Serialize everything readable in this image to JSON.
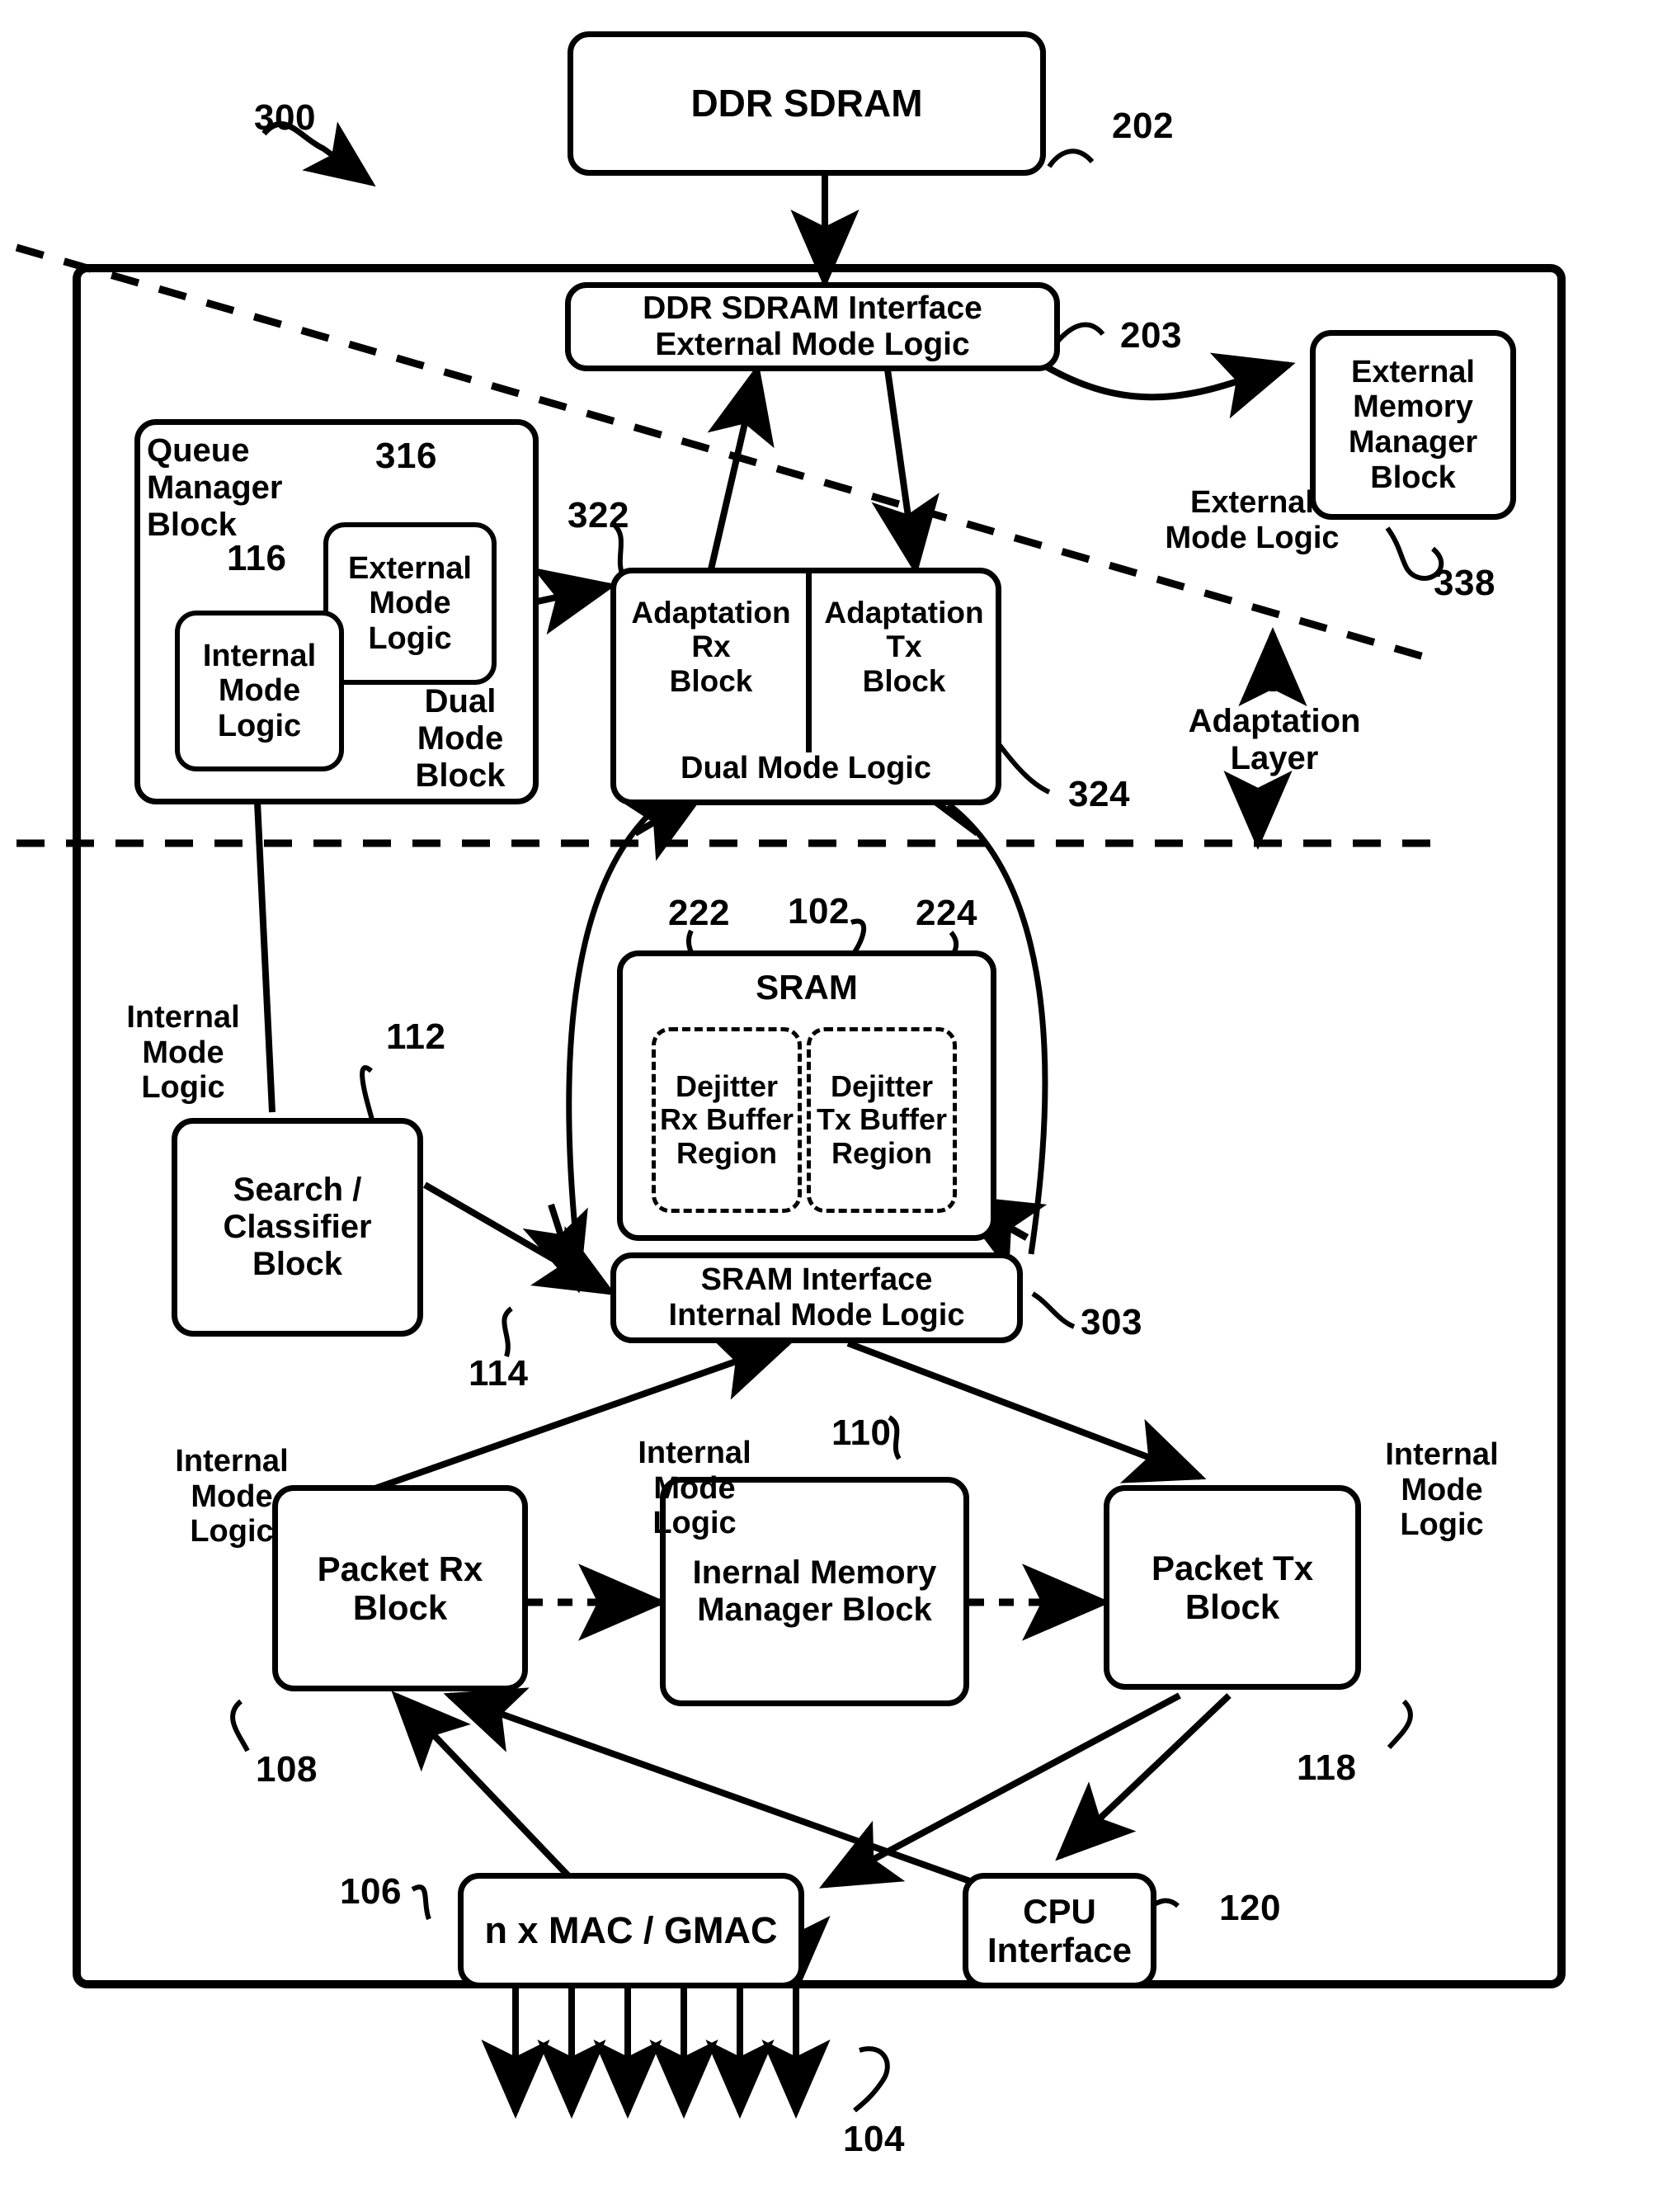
{
  "figure": {
    "ref_main": "300",
    "layer_label": "Adaptation\nLayer"
  },
  "blocks": {
    "ddr_sdram": {
      "label": "DDR SDRAM",
      "ref": "202"
    },
    "ddr_interface": {
      "line1": "DDR SDRAM Interface",
      "line2": "External Mode Logic",
      "ref": "203"
    },
    "external_memory_manager": {
      "label": "External\nMemory\nManager\nBlock",
      "ref": "338",
      "mode_label": "External\nMode Logic"
    },
    "queue_manager": {
      "title": "Queue\nManager\nBlock",
      "dual_mode": "Dual\nMode\nBlock"
    },
    "queue_internal_mode": {
      "label": "Internal\nMode\nLogic",
      "ref": "116"
    },
    "queue_external_mode": {
      "label": "External\nMode\nLogic",
      "ref": "316"
    },
    "adaptation_rx": {
      "label": "Adaptation\nRx\nBlock",
      "ref": "322"
    },
    "adaptation_tx": {
      "label": "Adaptation\nTx\nBlock",
      "ref": "324"
    },
    "adaptation_dual_mode": {
      "label": "Dual Mode Logic"
    },
    "sram": {
      "label": "SRAM",
      "ref": "102"
    },
    "dejitter_rx": {
      "label": "Dejitter\nRx\nBuffer\nRegion",
      "ref": "222"
    },
    "dejitter_tx": {
      "label": "Dejitter\nTx\nBuffer\nRegion",
      "ref": "224"
    },
    "sram_interface": {
      "line1": "SRAM Interface",
      "line2": "Internal Mode Logic",
      "ref": "303"
    },
    "search_classifier": {
      "label": "Search /\nClassifier\nBlock",
      "ref": "112",
      "mode_label": "Internal\nMode\nLogic",
      "link_ref": "114"
    },
    "packet_rx": {
      "label": "Packet\nRx Block",
      "ref": "108",
      "mode_label": "Internal\nMode\nLogic"
    },
    "internal_memory_manager": {
      "label": "Inernal\nMemory\nManager\nBlock",
      "ref": "110",
      "mode_label": "Internal\nMode\nLogic"
    },
    "packet_tx": {
      "label": "Packet\nTx Block",
      "ref": "118",
      "mode_label": "Internal\nMode\nLogic"
    },
    "mac_gmac": {
      "label": "n x MAC / GMAC",
      "ref": "106"
    },
    "cpu_interface": {
      "label": "CPU\nInterface",
      "ref": "120"
    },
    "external_ports": {
      "ref": "104",
      "count": 6
    }
  }
}
